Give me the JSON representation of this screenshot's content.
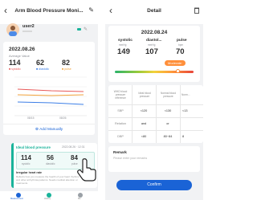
{
  "colors": {
    "systolic": "#e85a5a",
    "diastolic": "#3c7ee6",
    "pulse": "#f2a23b",
    "primary": "#1a63d6",
    "highlight": "#ff8f3a",
    "accent_green": "#19b39a"
  },
  "left": {
    "header": {
      "back_icon": "chevron-left-icon",
      "title": "Arm Blood Pressure Moni...",
      "edit_icon": "pencil-icon"
    },
    "user": {
      "name": "user2",
      "edit_icon": "pencil-icon"
    },
    "summary": {
      "date": "2022.08.26",
      "caption": "Average Value",
      "systolic": "114",
      "diastolic": "62",
      "pulse": "82",
      "legend": [
        "systolic",
        "diastolic",
        "pulse"
      ],
      "x_labels": [
        "08/15",
        "08/26"
      ]
    },
    "add_manually": "Add Manually",
    "recent": {
      "title": "Ideal blood pressure",
      "datetime": "2022.08.26 · 12:31",
      "systolic": "114",
      "diastolic": "56",
      "pulse": "84",
      "note": "Irregular heart rate",
      "note_detail": "Reflects how you measure the health of your heart rhythms and other arrhythmia patterns. Needs medical attention or treatments."
    },
    "bottom_nav": [
      "Measurement",
      "History",
      "Me"
    ]
  },
  "right": {
    "header": {
      "back_icon": "chevron-left-icon",
      "title": "Detail",
      "delete_icon": "trash-icon"
    },
    "date": "2022.08.24",
    "labels": [
      "systolic",
      "diastol...",
      "pulse"
    ],
    "units": [
      "mmHg",
      "mmHg",
      "bpm"
    ],
    "values": [
      "149",
      "107",
      "70"
    ],
    "status": "Moderate",
    "gauge_fraction": 0.8,
    "table": {
      "headers": [
        "WHO blood pressure reference",
        "Ideal blood pressure",
        "Normal blood pressure",
        "Norm..."
      ],
      "rows": [
        [
          "SBP",
          "<120",
          "<130",
          "<13"
        ],
        [
          "Relation",
          "and",
          "or",
          ""
        ],
        [
          "DBP",
          "<80",
          "80~84",
          "8"
        ]
      ]
    },
    "remark": {
      "title": "Remark",
      "placeholder": "Please enter your remarks"
    },
    "confirm": "Confirm"
  }
}
